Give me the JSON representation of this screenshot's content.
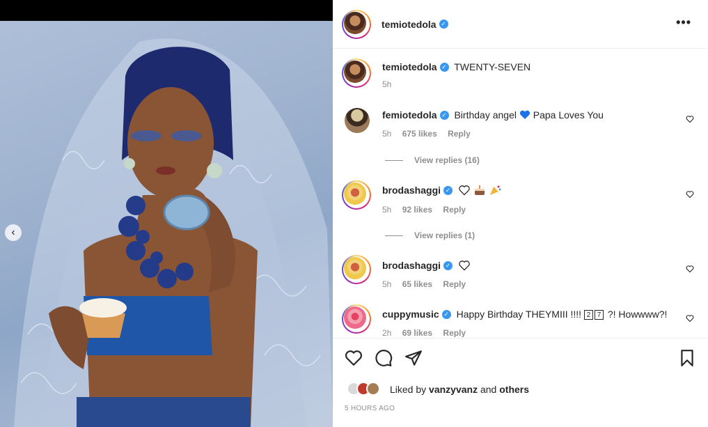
{
  "post": {
    "author": "temiotedola",
    "caption": "TWENTY-SEVEN",
    "caption_time": "5h",
    "more_label": "•••"
  },
  "comments": [
    {
      "username": "femiotedola",
      "text_before": "Birthday angel",
      "text_after": "Papa Loves You",
      "time": "5h",
      "likes": "675 likes",
      "reply": "Reply",
      "view_replies": "View replies (16)"
    },
    {
      "username": "brodashaggi",
      "time": "5h",
      "likes": "92 likes",
      "reply": "Reply",
      "view_replies": "View replies (1)"
    },
    {
      "username": "brodashaggi",
      "time": "5h",
      "likes": "65 likes",
      "reply": "Reply"
    },
    {
      "username": "cuppymusic",
      "text_before": "Happy Birthday THEYMIII !!!!",
      "box1": "2",
      "box2": "7",
      "text_after": "?! Howwww?!",
      "time": "2h",
      "likes": "69 likes",
      "reply": "Reply"
    }
  ],
  "liked_by": {
    "prefix": "Liked by",
    "user": "vanzyvanz",
    "joiner": "and",
    "others": "others"
  },
  "timestamp": "5 HOURS AGO",
  "colors": {
    "verified": "#3897f0",
    "muted": "#8e8e8e",
    "text": "#262626"
  }
}
